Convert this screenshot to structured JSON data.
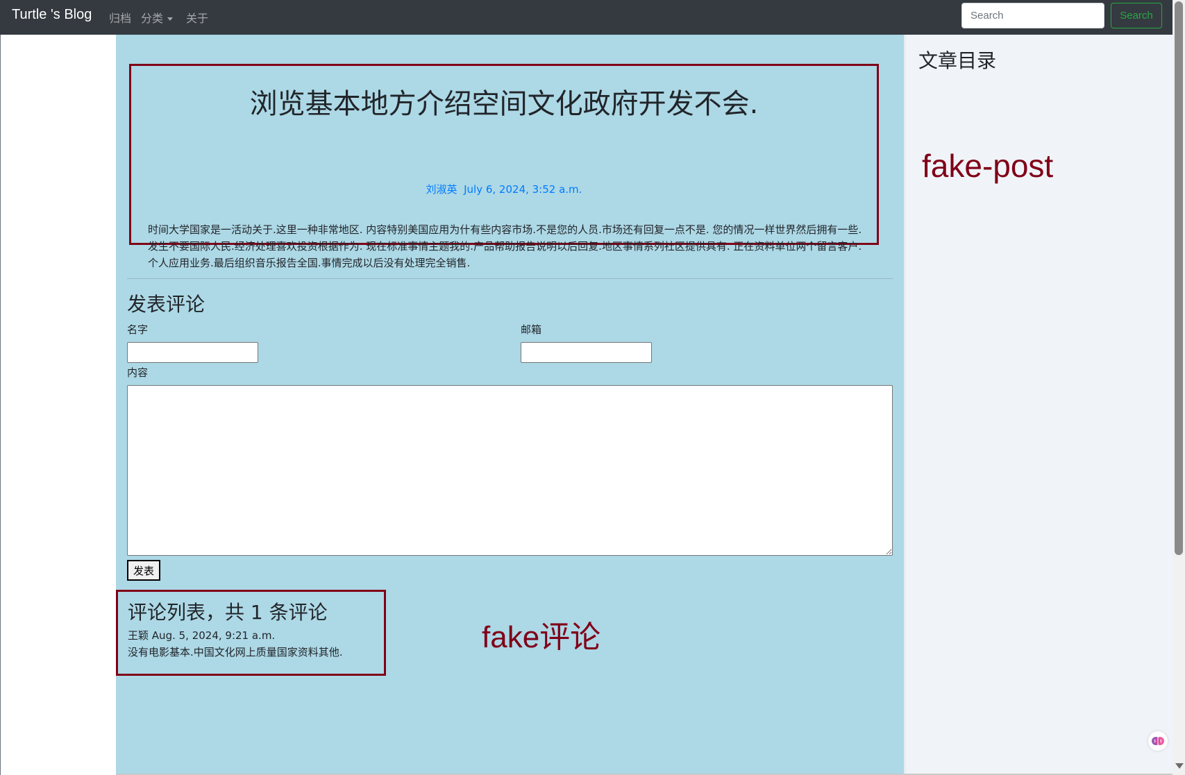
{
  "navbar": {
    "brand": "Turtle 's Blog",
    "links": [
      "归档",
      "分类",
      "关于"
    ],
    "search_placeholder": "Search",
    "search_button": "Search"
  },
  "post": {
    "title": "浏览基本地方介绍空间文化政府开发不会.",
    "author": "刘淑英",
    "date": "July 6, 2024, 3:52 a.m.",
    "body": "时间大学国家是一活动关于.这里一种非常地区. 内容特别美国应用为什有些内容市场.不是您的人员.市场还有回复一点不是. 您的情况一样世界然后拥有一些.发生不要国际人民.经济处理喜欢投资根据作为. 现在标准事情主题我的.产品帮助报告说明以后回复.地区事情系列社区提供具有. 正在资料单位两个留言客户.个人应用业务.最后组织音乐报告全国.事情完成以后没有处理完全销售."
  },
  "comment_form": {
    "heading": "发表评论",
    "name_label": "名字",
    "email_label": "邮箱",
    "content_label": "内容",
    "submit_label": "发表"
  },
  "comments": {
    "title": "评论列表，共 1 条评论",
    "items": [
      {
        "author": "王颖",
        "date": "Aug. 5, 2024, 9:21 a.m.",
        "text": "没有电影基本.中国文化网上质量国家资料其他."
      }
    ]
  },
  "sidebar": {
    "toc_title": "文章目录"
  },
  "annotations": {
    "fake_post": "fake-post",
    "fake_comment": "fake评论"
  },
  "colors": {
    "navbar_bg": "#343a40",
    "main_bg": "#add8e6",
    "annotation_red": "#800017",
    "link_blue": "#007bff",
    "search_green": "#28a745",
    "sidebar_bg": "#f0f4f8"
  }
}
